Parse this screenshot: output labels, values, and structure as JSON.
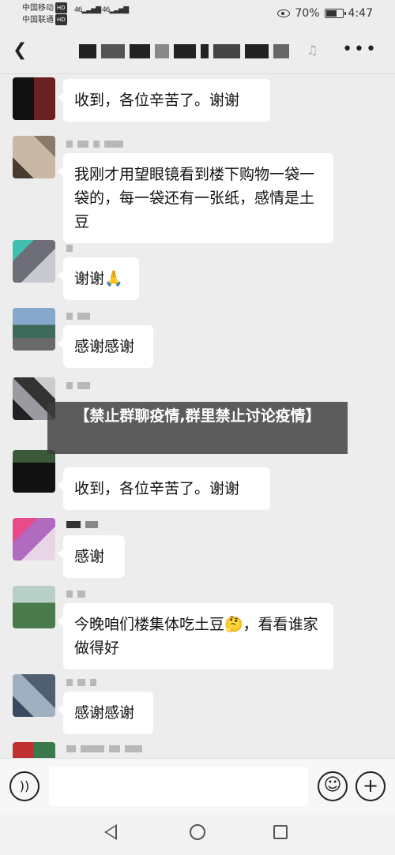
{
  "status_bar": {
    "carrier_1": "中国移动",
    "carrier_2": "中国联通",
    "hd_badge": "HD",
    "network_1": "46",
    "network_2": "46",
    "battery_percent": "70%",
    "battery_level": 0.7,
    "time": "4:47"
  },
  "header": {
    "back_icon": "chevron-left-icon",
    "mute_icon": "bell-off-icon",
    "more_icon": "more-horizontal-icon"
  },
  "messages": [
    {
      "text": "收到，各位辛苦了。谢谢"
    },
    {
      "text": "我刚才用望眼镜看到楼下购物一袋一袋的，每一袋还有一张纸，感情是土豆"
    },
    {
      "text": "谢谢🙏"
    },
    {
      "text": "感谢感谢"
    },
    {
      "text": "收到，各位辛苦了。谢谢"
    },
    {
      "text": "感谢"
    },
    {
      "text": "今晚咱们楼集体吃土豆🤔，看看谁家做得好"
    },
    {
      "text": "感谢感谢"
    }
  ],
  "overlay": {
    "headline": "【禁止群聊疫情,群里禁止讨论疫情】"
  },
  "input_bar": {
    "voice_icon": "voice-icon",
    "emoji_icon": "emoji-icon",
    "plus_icon": "plus-icon"
  },
  "nav": {
    "back_icon": "nav-back-icon",
    "home_icon": "nav-home-icon",
    "recent_icon": "nav-recent-icon"
  }
}
